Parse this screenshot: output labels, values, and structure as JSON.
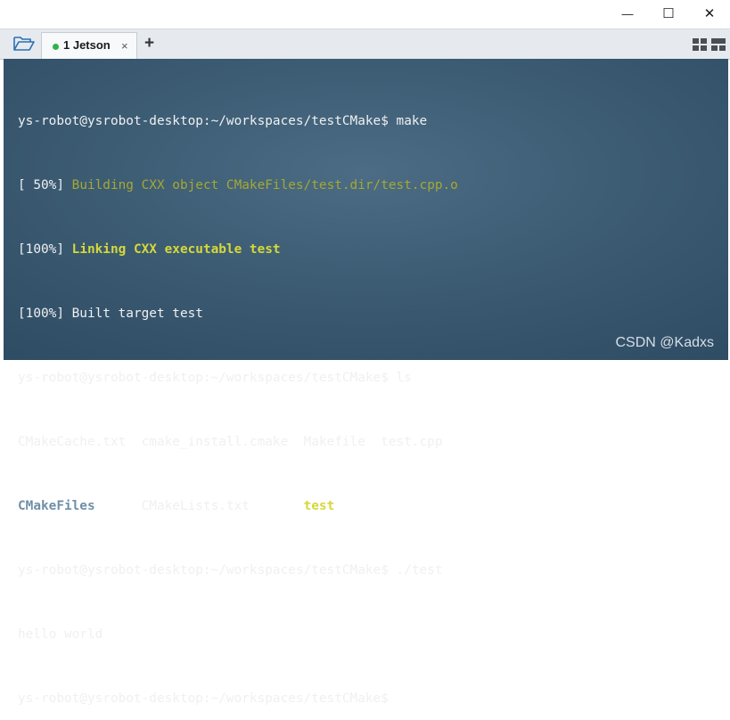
{
  "window": {
    "minimize_glyph": "—",
    "maximize_glyph": "☐",
    "close_glyph": "✕"
  },
  "tabbar": {
    "tab_label": "1 Jetson",
    "tab_close_glyph": "×",
    "new_tab_glyph": "+",
    "icons": [
      "folder-icon",
      "layout-icon",
      "tile-icon"
    ],
    "status_dot_color": "#2fb34a"
  },
  "terminal": {
    "lines": {
      "l0": {
        "a": "ys-robot@ysrobot-desktop:~/workspaces/testCMake$ make"
      },
      "l1": {
        "a": "[ 50%] ",
        "b": "Building CXX object CMakeFiles/test.dir/test.cpp.o"
      },
      "l2": {
        "a": "[100%] ",
        "b": "Linking CXX executable test"
      },
      "l3": {
        "a": "[100%] Built target test"
      },
      "l4": {
        "a": "ys-robot@ysrobot-desktop:~/workspaces/testCMake$ ls"
      },
      "l5": {
        "a": "CMakeCache.txt  cmake_install.cmake  Makefile  test.cpp"
      },
      "l6": {
        "a": "CMakeFiles",
        "b": "      CMakeLists.txt       ",
        "c": "test"
      },
      "l7": {
        "a": "ys-robot@ysrobot-desktop:~/workspaces/testCMake$ ./test"
      },
      "l8": {
        "a": "hello world"
      },
      "l9": {
        "a": "ys-robot@ysrobot-desktop:~/workspaces/testCMake$"
      }
    },
    "colors": {
      "background": "#3d5d75",
      "text": "#f0f0f0",
      "building": "#a6a832",
      "linking": "#d6d83a",
      "directory": "#6f8fa7"
    },
    "watermark": "CSDN @Kadxs"
  }
}
